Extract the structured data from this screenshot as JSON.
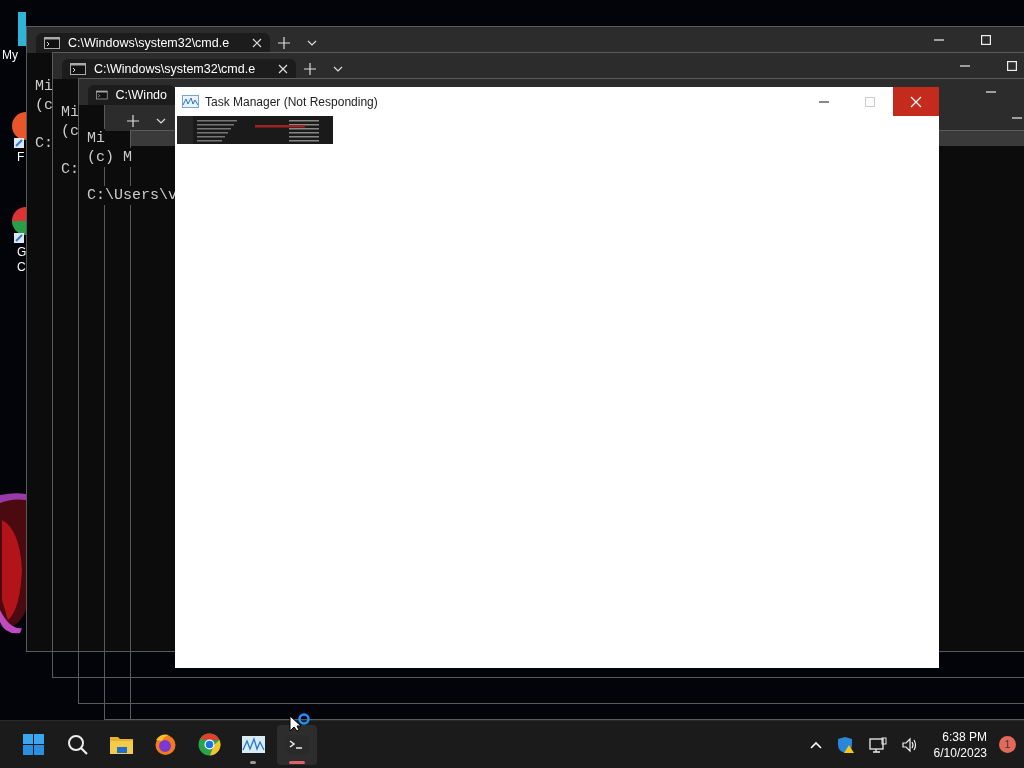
{
  "desktop_icons": [
    {
      "kind": "computer",
      "label": [
        "My"
      ]
    },
    {
      "kind": "browser-orange",
      "label": [
        "F"
      ]
    },
    {
      "kind": "browser-green",
      "label": [
        "G",
        "C"
      ]
    }
  ],
  "windows": [
    {
      "kind": "terminal",
      "tab": {
        "title": "C:\\Windows\\system32\\cmd.e"
      },
      "buttons": [
        {
          "kind": "new-tab"
        },
        {
          "kind": "dropdown"
        },
        {
          "kind": "minimize"
        },
        {
          "kind": "maximize"
        }
      ],
      "paragraphs": [
        [
          "Mi",
          "(c"
        ],
        [
          "C:"
        ]
      ]
    },
    {
      "kind": "terminal",
      "tab": {
        "title": "C:\\Windows\\system32\\cmd.e"
      },
      "buttons": [
        {
          "kind": "new-tab"
        },
        {
          "kind": "dropdown"
        },
        {
          "kind": "minimize"
        },
        {
          "kind": "maximize"
        }
      ],
      "paragraphs": [
        [
          "Mi",
          "(c"
        ],
        [
          "C:"
        ]
      ]
    },
    {
      "kind": "terminal",
      "tab": {
        "title": "C:\\Windo"
      },
      "buttons": [
        {
          "kind": "minimize"
        }
      ],
      "paragraphs": [
        [
          "Mi",
          "(c) M"
        ],
        [
          "C:\\Users\\v"
        ]
      ]
    },
    {
      "kind": "terminal",
      "buttons": [
        {
          "kind": "new-tab"
        },
        {
          "kind": "dropdown"
        },
        {
          "kind": "minimize"
        }
      ]
    },
    {
      "kind": "blank"
    }
  ],
  "task_manager": {
    "title": "Task Manager (Not Responding)"
  },
  "taskbar": {
    "apps": [
      {
        "kind": "start",
        "running": false,
        "active": false
      },
      {
        "kind": "search",
        "running": false,
        "active": false
      },
      {
        "kind": "folder",
        "running": false,
        "active": false
      },
      {
        "kind": "firefox",
        "running": false,
        "active": false
      },
      {
        "kind": "chrome",
        "running": false,
        "active": false
      },
      {
        "kind": "task-manager",
        "running": true,
        "active": false
      },
      {
        "kind": "terminal",
        "running": true,
        "active": true
      }
    ],
    "clock": {
      "time": "6:38 PM",
      "date": "6/10/2023"
    },
    "notifications": "1"
  }
}
